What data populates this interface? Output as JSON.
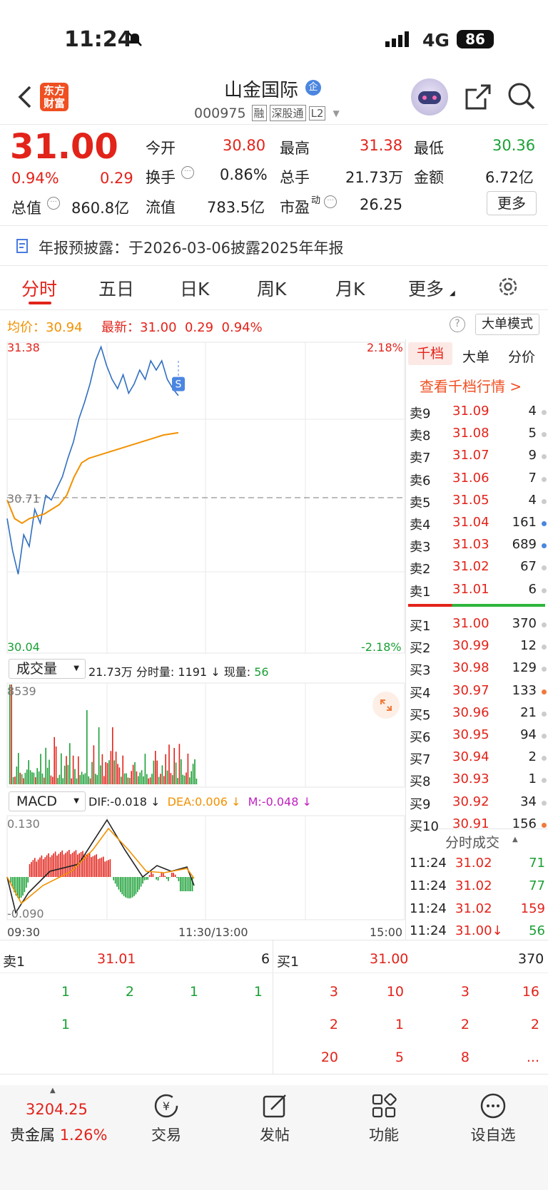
{
  "status_bar": {
    "time": "11:24",
    "network": "4G",
    "battery": "86"
  },
  "header": {
    "back_icon": "chevron-left-icon",
    "logo_line1": "东方",
    "logo_line2": "财富",
    "stock_name": "山金国际",
    "badge": "企",
    "code": "000975",
    "tags": [
      "融",
      "深股通",
      "L2"
    ],
    "share_icon": "share-icon",
    "search_icon": "search-icon"
  },
  "quote": {
    "price": "31.00",
    "pct": "0.94%",
    "change": "0.29",
    "open_label": "今开",
    "open": "30.80",
    "high_label": "最高",
    "high": "31.38",
    "low_label": "最低",
    "low": "30.36",
    "turnover_label": "换手",
    "turnover": "0.86%",
    "volume_label": "总手",
    "volume": "21.73万",
    "amount_label": "金额",
    "amount": "6.72亿",
    "mcap_label": "总值",
    "mcap": "860.8亿",
    "float_label": "流值",
    "float": "783.5亿",
    "pe_label": "市盈",
    "pe_sup": "动",
    "pe": "26.25",
    "more": "更多"
  },
  "notice": {
    "text": "年报预披露：于2026-03-06披露2025年年报"
  },
  "tabs": [
    "分时",
    "五日",
    "日K",
    "周K",
    "月K",
    "更多"
  ],
  "chart_info": {
    "avg_label": "均价：",
    "avg": "30.94",
    "latest_label": "最新：",
    "latest": "31.00",
    "change": "0.29",
    "pct": "0.94%",
    "mode_button": "大单模式"
  },
  "chart_data": {
    "type": "line",
    "title": "",
    "y_max": "31.38",
    "y_min": "30.04",
    "pct_max": "2.18%",
    "pct_min": "-2.18%",
    "base": "30.71",
    "x_labels": [
      "09:30",
      "11:30/13:00",
      "15:00"
    ],
    "ylim": [
      30.04,
      31.38
    ],
    "series": [
      {
        "name": "",
        "color": "#2f6fc0",
        "values": [
          30.62,
          30.48,
          30.38,
          30.55,
          30.5,
          30.66,
          30.6,
          30.72,
          30.7,
          30.75,
          30.8,
          30.88,
          30.95,
          31.05,
          31.12,
          31.2,
          31.3,
          31.36,
          31.28,
          31.22,
          31.18,
          31.24,
          31.16,
          31.2,
          31.26,
          31.22,
          31.3,
          31.26,
          31.3,
          31.22,
          31.18,
          31.15
        ]
      },
      {
        "name": "",
        "color": "#f29100",
        "values": [
          30.7,
          30.62,
          30.6,
          30.62,
          30.63,
          30.64,
          30.66,
          30.68,
          30.72,
          30.8,
          30.86,
          30.88,
          30.89,
          30.9,
          30.91,
          30.92,
          30.93,
          30.94,
          30.95,
          30.96,
          30.97,
          30.98,
          30.985,
          30.99
        ]
      }
    ]
  },
  "volume": {
    "label": "成交量",
    "total": "21.73万",
    "minute_label": "分时量:",
    "minute": "1191",
    "arrow": "↓",
    "now_label": "现量:",
    "now": "56",
    "max": "8539"
  },
  "macd": {
    "label": "MACD",
    "dif": "DIF:-0.018",
    "dea": "DEA:0.006",
    "m": "M:-0.048",
    "top": "0.130",
    "bottom": "-0.090"
  },
  "book_tabs": [
    "千档",
    "大单",
    "分价"
  ],
  "book_link": "查看千档行情 >",
  "sells": [
    [
      "卖9",
      "31.09",
      "4"
    ],
    [
      "卖8",
      "31.08",
      "5"
    ],
    [
      "卖7",
      "31.07",
      "9"
    ],
    [
      "卖6",
      "31.06",
      "7"
    ],
    [
      "卖5",
      "31.05",
      "4"
    ],
    [
      "卖4",
      "31.04",
      "161"
    ],
    [
      "卖3",
      "31.03",
      "689"
    ],
    [
      "卖2",
      "31.02",
      "67"
    ],
    [
      "卖1",
      "31.01",
      "6"
    ]
  ],
  "buys": [
    [
      "买1",
      "31.00",
      "370"
    ],
    [
      "买2",
      "30.99",
      "12"
    ],
    [
      "买3",
      "30.98",
      "129"
    ],
    [
      "买4",
      "30.97",
      "133"
    ],
    [
      "买5",
      "30.96",
      "21"
    ],
    [
      "买6",
      "30.95",
      "94"
    ],
    [
      "买7",
      "30.94",
      "2"
    ],
    [
      "买8",
      "30.93",
      "1"
    ],
    [
      "买9",
      "30.92",
      "34"
    ],
    [
      "买10",
      "30.91",
      "156"
    ]
  ],
  "ticks_label": "分时成交",
  "ticks": [
    [
      "11:24",
      "31.02",
      "71"
    ],
    [
      "11:24",
      "31.02",
      "77"
    ],
    [
      "11:24",
      "31.02",
      "159"
    ],
    [
      "11:24",
      "31.00↓",
      "56"
    ]
  ],
  "queue": {
    "sell_label": "卖1",
    "sell_price": "31.01",
    "sell_total": "6",
    "sell_orders": [
      "1",
      "2",
      "1",
      "1",
      "1"
    ],
    "buy_label": "买1",
    "buy_price": "31.00",
    "buy_total": "370",
    "buy_orders": [
      "3",
      "10",
      "3",
      "16",
      "2",
      "1",
      "2",
      "2",
      "20",
      "5",
      "8",
      "..."
    ]
  },
  "bottom": {
    "index_value": "3204.25",
    "index_name": "贵金属",
    "index_pct": "1.26%",
    "nav": [
      "交易",
      "发帖",
      "功能",
      "设自选"
    ]
  }
}
